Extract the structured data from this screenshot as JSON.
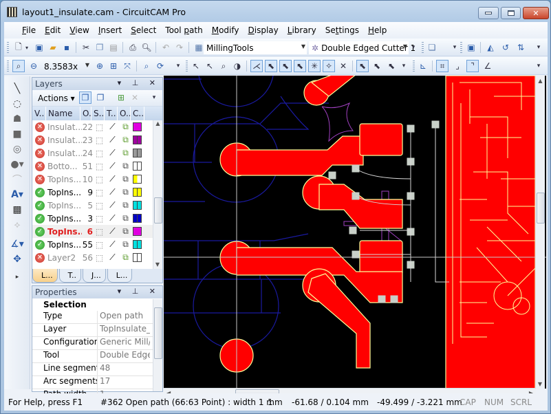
{
  "window": {
    "title": "layout1_insulate.cam - CircuitCAM Pro",
    "minimize": "minimize",
    "maximize": "maximize",
    "close": "close"
  },
  "menu": [
    {
      "label": "File",
      "accel": "F"
    },
    {
      "label": "Edit",
      "accel": "E"
    },
    {
      "label": "View",
      "accel": "V"
    },
    {
      "label": "Insert",
      "accel": "I"
    },
    {
      "label": "Select",
      "accel": "S"
    },
    {
      "label": "Tool path",
      "accel": "p"
    },
    {
      "label": "Modify",
      "accel": "M"
    },
    {
      "label": "Display",
      "accel": "D"
    },
    {
      "label": "Library",
      "accel": "L"
    },
    {
      "label": "Settings",
      "accel": "t"
    },
    {
      "label": "Help",
      "accel": "H"
    }
  ],
  "toolbar1": {
    "tool_library": "MillingTools",
    "tool": "Double Edged Cutter 1",
    "icons": [
      "new-icon",
      "open-project-icon",
      "open-folder-icon",
      "save-icon",
      "cut-icon",
      "copy-icon",
      "paste-icon",
      "print-icon",
      "print-preview-icon",
      "undo-icon",
      "redo-icon"
    ]
  },
  "toolbar2": {
    "zoom_value": "8.3583x",
    "icons": [
      "zoom-window-icon",
      "zoom-out-icon",
      "zoom-in-icon",
      "zoom-all-icon",
      "zoom-fit-icon",
      "zoom-previous-icon",
      "redraw-icon"
    ]
  },
  "layers_panel": {
    "title": "Layers",
    "actions_label": "Actions",
    "columns": [
      "V..",
      "Name",
      "O.",
      "S...",
      "T..",
      "O..",
      "C.."
    ],
    "rows": [
      {
        "visible": false,
        "name": "Insulat...",
        "order": "22",
        "dimmed": true,
        "swatch": "#e000e0",
        "swatch_style": "solid",
        "output": "green"
      },
      {
        "visible": false,
        "name": "Insulat...",
        "order": "23",
        "dimmed": true,
        "swatch": "#a000a0",
        "swatch_style": "split",
        "output": "green"
      },
      {
        "visible": false,
        "name": "Insulat...",
        "order": "24",
        "dimmed": true,
        "swatch": "#999999",
        "swatch_style": "split",
        "output": "green"
      },
      {
        "visible": false,
        "name": "Botto...",
        "order": "51",
        "dimmed": true,
        "swatch": "#ffffff",
        "swatch_style": "split",
        "output": "plain"
      },
      {
        "visible": false,
        "name": "TopIns...",
        "order": "10",
        "dimmed": true,
        "swatch": "#ffff00",
        "swatch_style": "half",
        "output": "plain"
      },
      {
        "visible": true,
        "name": "TopIns...",
        "order": "9",
        "dimmed": false,
        "swatch": "#ffff00",
        "swatch_style": "split",
        "output": "plain"
      },
      {
        "visible": true,
        "name": "TopIns...",
        "order": "5",
        "dimmed": true,
        "swatch": "#00e0e0",
        "swatch_style": "split",
        "output": "plain"
      },
      {
        "visible": true,
        "name": "TopIns...",
        "order": "3",
        "dimmed": false,
        "swatch": "#0000c8",
        "swatch_style": "split",
        "output": "plain"
      },
      {
        "visible": true,
        "name": "TopIns...",
        "order": "6",
        "dimmed": false,
        "active": true,
        "swatch": "#e000e0",
        "swatch_style": "solid",
        "output": "plain"
      },
      {
        "visible": true,
        "name": "TopIns...",
        "order": "55",
        "dimmed": false,
        "swatch": "#00e0e0",
        "swatch_style": "split",
        "output": "plain"
      },
      {
        "visible": false,
        "name": "Layer2",
        "order": "56",
        "dimmed": true,
        "swatch": "#ffffff",
        "swatch_style": "split",
        "output": "green"
      }
    ],
    "tabs": [
      "L...",
      "T..",
      "J...",
      "L..."
    ]
  },
  "properties_panel": {
    "title": "Properties",
    "section": "Selection",
    "rows": [
      {
        "key": "Type",
        "value": "Open path"
      },
      {
        "key": "Layer",
        "value": "TopInsulate_E"
      },
      {
        "key": "Configuration",
        "value": "Generic Mill/D"
      },
      {
        "key": "Tool",
        "value": "Double Edged"
      },
      {
        "key": "Line segments",
        "value": "48"
      },
      {
        "key": "Arc segments",
        "value": "17"
      },
      {
        "key": "Path width",
        "value": "1"
      }
    ]
  },
  "status": {
    "help": "For Help, press F1",
    "selection": "#362 Open path (66:63 Point) : width 1 mm",
    "count": "1",
    "delta": "-61.68 / 0.104 mm",
    "position": "-49.499 / -3.221 mm",
    "cap": "CAP",
    "num": "NUM",
    "scrl": "SCRL"
  },
  "colors": {
    "copper": "#ff0000",
    "insulate": "#ffff99",
    "grid": "#1a1aa0",
    "path": "#a040c0",
    "crosshair": "#c8c8c8"
  }
}
